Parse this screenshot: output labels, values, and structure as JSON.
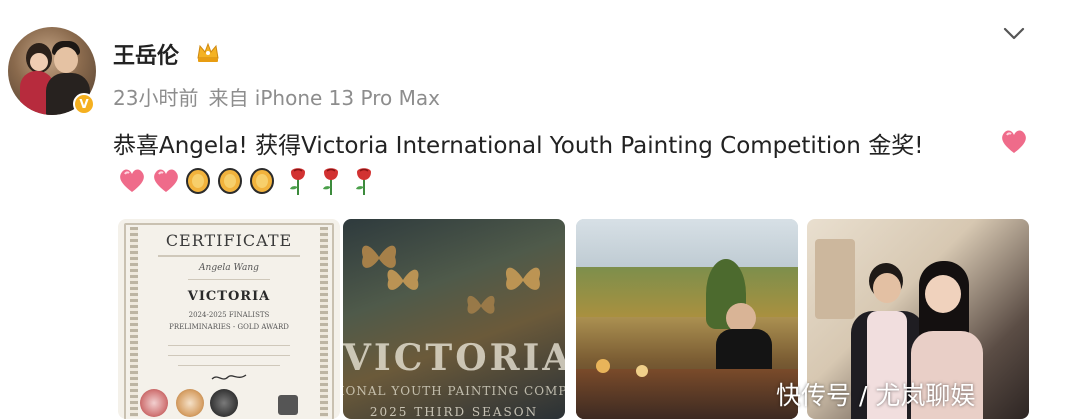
{
  "post": {
    "username": "王岳伦",
    "time": "23小时前",
    "source": "来自 iPhone 13 Pro Max",
    "text": "恭喜Angela! 获得Victoria International Youth Painting Competition 金奖!",
    "emojis": [
      "heart-emoji",
      "heart-emoji",
      "clap-emoji",
      "clap-emoji",
      "clap-emoji",
      "rose-emoji",
      "rose-emoji",
      "rose-emoji"
    ]
  },
  "thumbnails": {
    "certificate": {
      "title": "CERTIFICATE",
      "name": "Angela Wang",
      "brand": "VICTORIA",
      "line1": "2024-2025 FINALISTS",
      "line2": "PRELIMINARIES - GOLD AWARD"
    },
    "poster": {
      "title": "VICTORIA",
      "subtitle": "TIONAL YOUTH PAINTING COMPE",
      "season": "2025 THIRD SEASON"
    }
  },
  "watermark": "快传号 / 尤岚聊娱",
  "colors": {
    "text": "#222222",
    "meta": "#8d8d8d",
    "verified": "#f5b020",
    "heart": "#ef6b8a",
    "clap": "#f2b33d",
    "rose": "#d23232"
  }
}
